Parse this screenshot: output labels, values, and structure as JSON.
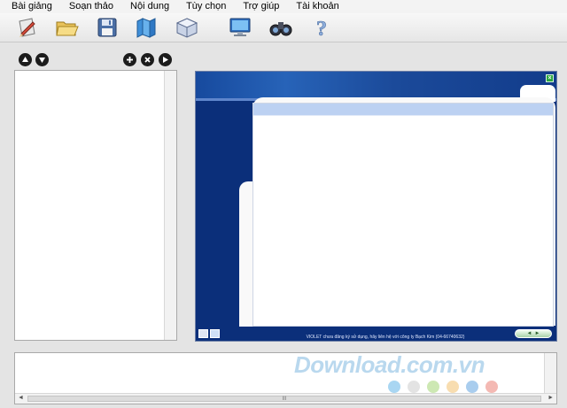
{
  "menu": {
    "items": [
      "Bài giảng",
      "Soạn thảo",
      "Nội dung",
      "Tùy chọn",
      "Trợ giúp",
      "Tài khoản"
    ]
  },
  "toolbar": {
    "buttons": [
      {
        "icon": "pencil-paper-icon"
      },
      {
        "icon": "open-folder-icon"
      },
      {
        "icon": "floppy-save-icon"
      },
      {
        "icon": "books-icon"
      },
      {
        "icon": "cube-icon"
      },
      {
        "icon": "monitor-icon"
      },
      {
        "icon": "binoculars-icon"
      },
      {
        "icon": "help-question-icon"
      }
    ]
  },
  "preview": {
    "close_glyph": "×",
    "notice": "VIOLET chưa đăng ký sử dụng, hãy liên hệ với công ty Bạch Kim (04-66740632)",
    "nav_prev": "◄",
    "nav_next": "►"
  },
  "bottom_panel": {
    "scroll_left": "◄",
    "scroll_right": "►",
    "scroll_grip": "III"
  },
  "watermark": {
    "text": "Download.com.vn",
    "dot_colors": [
      "#a9d6f2",
      "#e3e3e3",
      "#cde8b3",
      "#f8ddb0",
      "#a9cdee",
      "#f4b9b3"
    ]
  },
  "colors": {
    "preview_bg": "#0b2f7a",
    "page_header": "#bcd1f2",
    "window_bg": "#e4e4e4"
  }
}
